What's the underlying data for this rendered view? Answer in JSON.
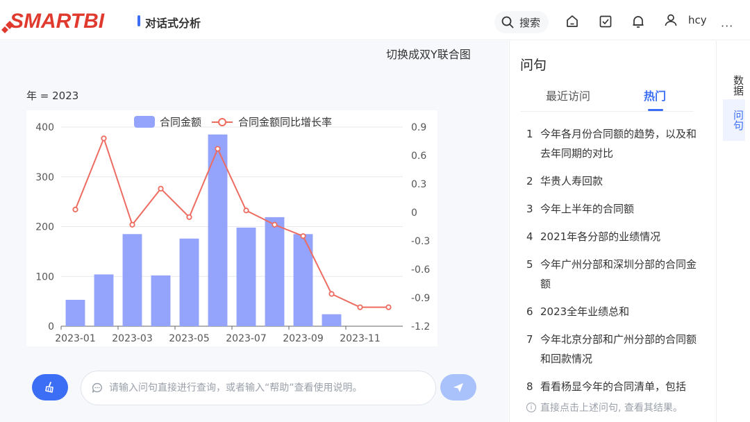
{
  "header": {
    "logo_text": "SMARTBI",
    "page_title": "对话式分析",
    "search_label": "搜索",
    "username": "hcy",
    "more": "···"
  },
  "main": {
    "switch_link": "切换成双Y联合图",
    "filter": "年 = 2023",
    "input_placeholder": "请输入问句直接进行查询，或者输入“帮助”查看使用说明。"
  },
  "chart_data": {
    "type": "bar+line",
    "x": [
      "2023-01",
      "2023-02",
      "2023-03",
      "2023-04",
      "2023-05",
      "2023-06",
      "2023-07",
      "2023-08",
      "2023-09",
      "2023-10",
      "2023-11",
      "2023-12"
    ],
    "x_tick_labels": [
      "2023-01",
      "2023-03",
      "2023-05",
      "2023-07",
      "2023-09",
      "2023-11"
    ],
    "series": [
      {
        "name": "合同金额",
        "type": "bar",
        "axis": "left",
        "color": "#94a3fb",
        "values": [
          53,
          104,
          185,
          102,
          176,
          385,
          198,
          219,
          185,
          24,
          0,
          0
        ]
      },
      {
        "name": "合同金额同比增长率",
        "type": "line",
        "axis": "right",
        "color": "#ee6b60",
        "values": [
          0.03,
          0.78,
          -0.13,
          0.25,
          -0.05,
          0.67,
          0.02,
          -0.13,
          -0.25,
          -0.86,
          -1.0,
          -1.0
        ]
      }
    ],
    "y_left": {
      "min": 0,
      "max": 400,
      "ticks": [
        "0",
        "100",
        "200",
        "300",
        "400"
      ]
    },
    "y_right": {
      "min": -1.2,
      "max": 0.9,
      "ticks": [
        "-1.2",
        "-0.9",
        "-0.6",
        "-0.3",
        "0",
        "0.3",
        "0.6",
        "0.9"
      ]
    },
    "legend_position": "top-center",
    "grid": true
  },
  "right_panel": {
    "title": "问句",
    "tabs": [
      "最近访问",
      "热门"
    ],
    "active_tab": "热门",
    "questions": [
      {
        "num": "1",
        "text": "今年各月份合同额的趋势，以及和去年同期的对比"
      },
      {
        "num": "2",
        "text": "华贵人寿回款"
      },
      {
        "num": "3",
        "text": "今年上半年的合同额"
      },
      {
        "num": "4",
        "text": "2021年各分部的业绩情况"
      },
      {
        "num": "5",
        "text": "今年广州分部和深圳分部的合同金额"
      },
      {
        "num": "6",
        "text": "2023全年业绩总和"
      },
      {
        "num": "7",
        "text": "今年北京分部和广州分部的合同额和回款情况"
      },
      {
        "num": "8",
        "text": "看看杨显今年的合同清单，包括"
      }
    ],
    "hint": "直接点击上述问句, 查看其结果。"
  },
  "side_tabs": {
    "data": "数据",
    "ask": "问句"
  },
  "colors": {
    "accent": "#3b6ef5",
    "bar": "#94a3fb",
    "line": "#ee6b60",
    "logo": "#e03a2f"
  },
  "icons": [
    "search-icon",
    "home-icon",
    "task-icon",
    "bell-icon",
    "user-icon",
    "broom-icon",
    "chat-icon",
    "send-icon",
    "info-icon"
  ]
}
